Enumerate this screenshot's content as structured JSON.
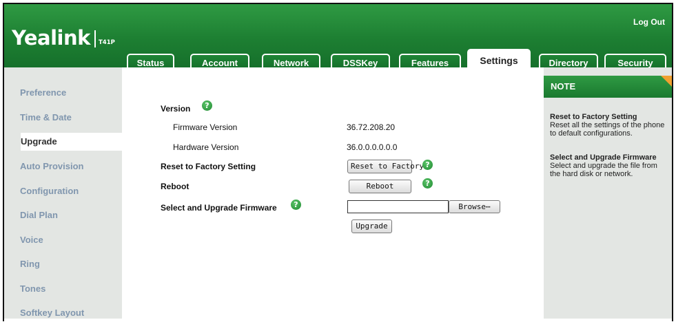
{
  "header": {
    "logo": "Yealink",
    "model": "T41P",
    "logout_label": "Log Out",
    "tabs": [
      {
        "label": "Status"
      },
      {
        "label": "Account"
      },
      {
        "label": "Network"
      },
      {
        "label": "DSSKey"
      },
      {
        "label": "Features"
      },
      {
        "label": "Settings",
        "active": true
      },
      {
        "label": "Directory"
      },
      {
        "label": "Security"
      }
    ]
  },
  "sidebar": {
    "items": [
      {
        "label": "Preference"
      },
      {
        "label": "Time & Date"
      },
      {
        "label": "Upgrade",
        "active": true
      },
      {
        "label": "Auto Provision"
      },
      {
        "label": "Configuration"
      },
      {
        "label": "Dial Plan"
      },
      {
        "label": "Voice"
      },
      {
        "label": "Ring"
      },
      {
        "label": "Tones"
      },
      {
        "label": "Softkey Layout"
      }
    ]
  },
  "main": {
    "version_label": "Version",
    "firmware_version_label": "Firmware Version",
    "firmware_version_value": "36.72.208.20",
    "hardware_version_label": "Hardware Version",
    "hardware_version_value": "36.0.0.0.0.0.0",
    "reset_label": "Reset to Factory Setting",
    "reset_button": "Reset to Factory",
    "reboot_label": "Reboot",
    "reboot_button": "Reboot",
    "upgrade_fw_label": "Select and Upgrade Firmware",
    "file_value": "",
    "browse_button": "Browse⋯",
    "upgrade_button": "Upgrade",
    "help_glyph": "?"
  },
  "note": {
    "title": "NOTE",
    "sections": [
      {
        "heading": "Reset to Factory Setting",
        "text": "Reset all the settings of the phone to default configurations."
      },
      {
        "heading": "Select and Upgrade Firmware",
        "text": "Select and upgrade the file from the hard disk or network."
      }
    ]
  },
  "colors": {
    "header_green": "#1d7f32",
    "sidebar_bg": "#e3e6e3",
    "sidebar_link": "#8096ae",
    "note_corner": "#f0a030"
  }
}
